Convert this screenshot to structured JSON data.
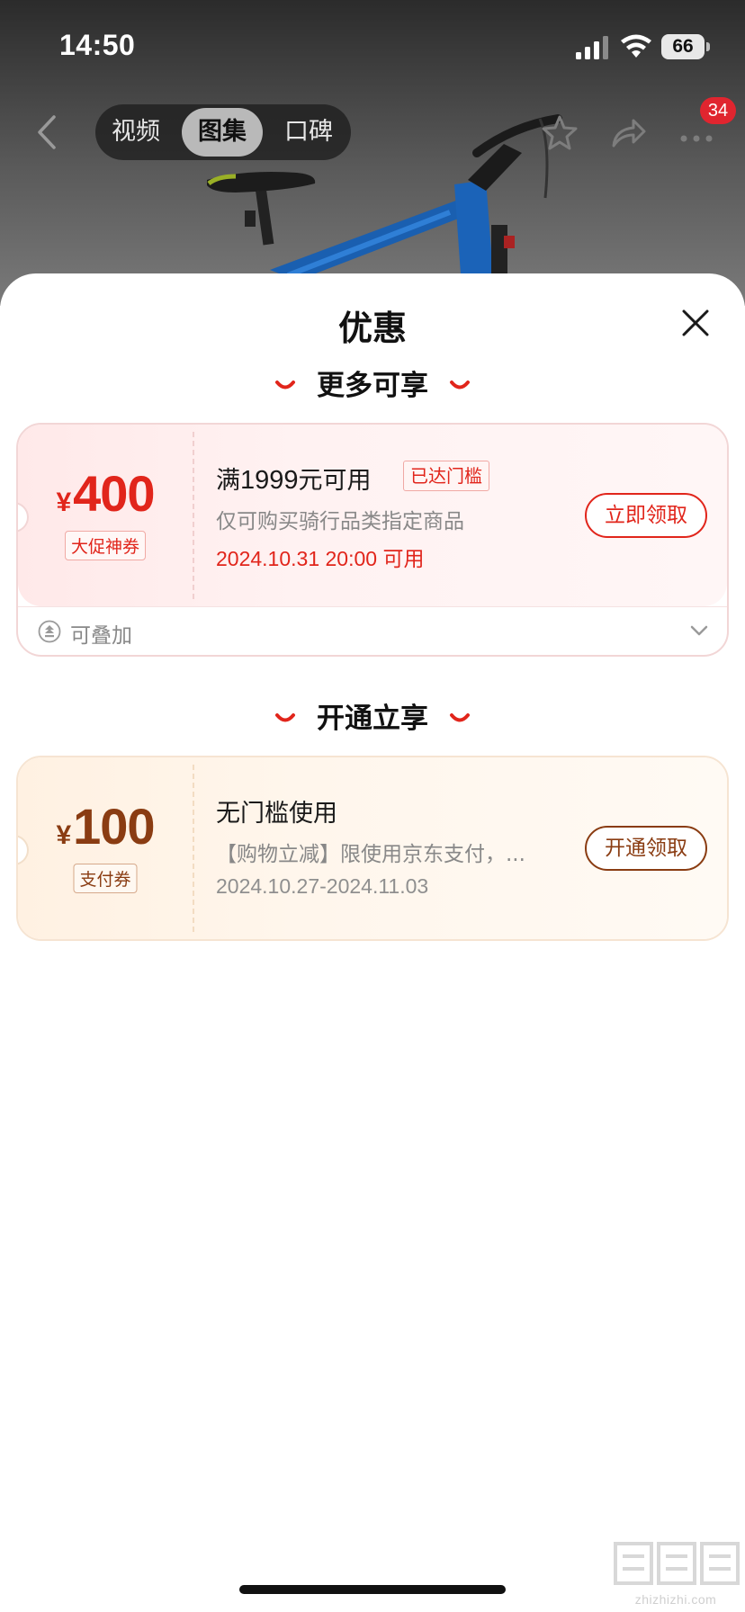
{
  "status_bar": {
    "time": "14:50",
    "battery": "66"
  },
  "nav": {
    "tabs": [
      {
        "label": "视频"
      },
      {
        "label": "图集",
        "active": true
      },
      {
        "label": "口碑"
      }
    ],
    "more_badge": "34"
  },
  "sheet": {
    "title": "优惠",
    "sections": [
      {
        "heading": "更多可享",
        "coupon": {
          "currency": "¥",
          "amount": "400",
          "type_label": "大促神券",
          "title_prefix": "满",
          "title_number": "1999",
          "title_suffix": "元可用",
          "status_tag": "已达门槛",
          "description": "仅可购买骑行品类指定商品",
          "valid_time": "2024.10.31 20:00 可用",
          "button": "立即领取",
          "stack_label": "可叠加"
        }
      },
      {
        "heading": "开通立享",
        "coupon": {
          "currency": "¥",
          "amount": "100",
          "type_label": "支付券",
          "title": "无门槛使用",
          "description": "【购物立减】限使用京东支付，...",
          "valid_time": "2024.10.27-2024.11.03",
          "button": "开通领取"
        }
      }
    ]
  },
  "watermark": {
    "text": "zhizhizhi.com"
  },
  "colors": {
    "accent_red": "#e1251b",
    "accent_brown": "#8a3c12",
    "badge_red": "#e0252f"
  }
}
